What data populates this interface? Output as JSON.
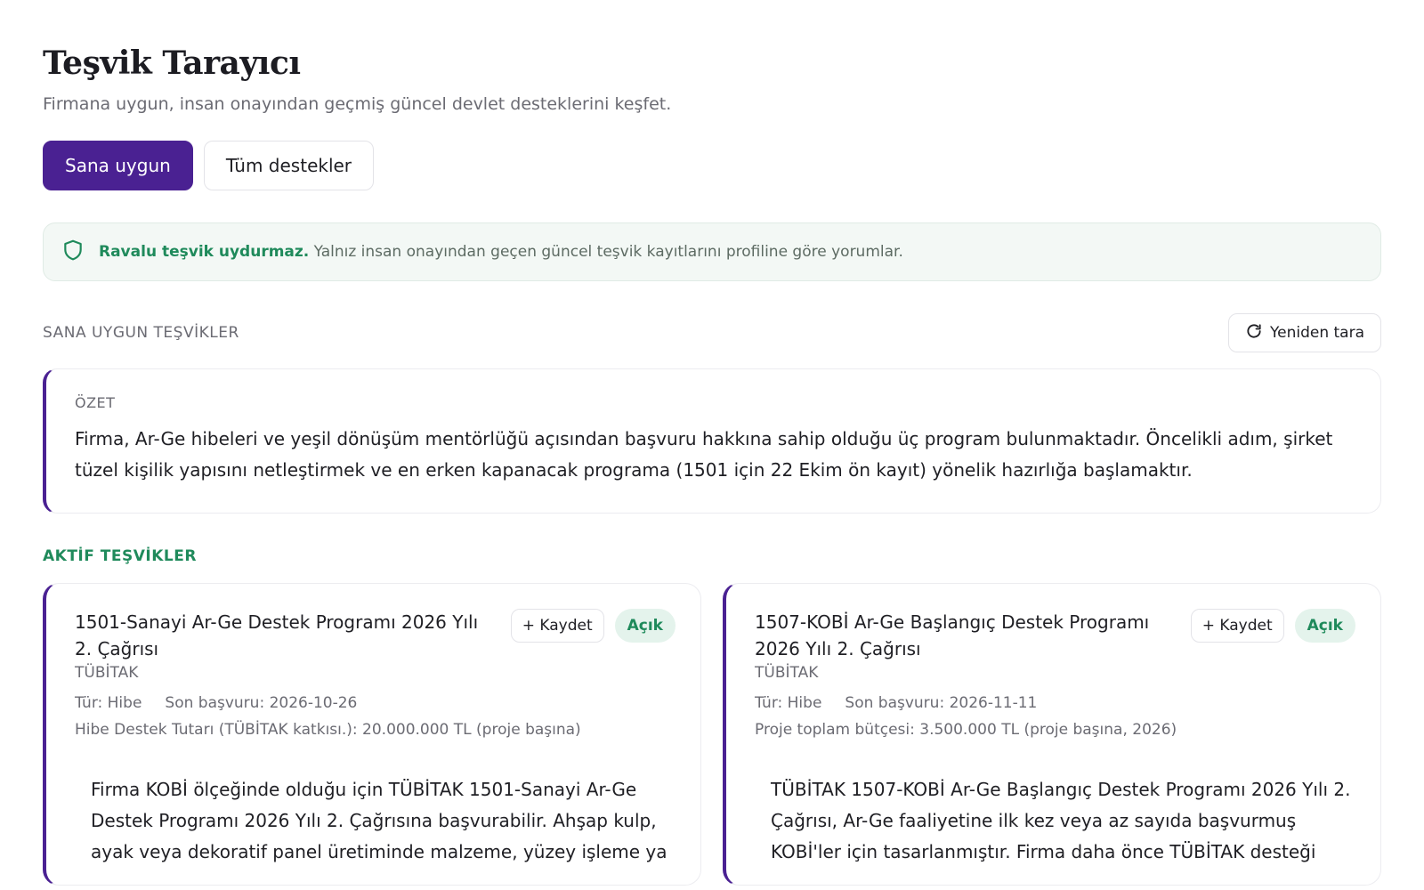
{
  "header": {
    "title": "Teşvik Tarayıcı",
    "subtitle": "Firmana uygun, insan onayından geçmiş güncel devlet desteklerini keşfet."
  },
  "tabs": [
    {
      "label": "Sana uygun",
      "active": true
    },
    {
      "label": "Tüm destekler",
      "active": false
    }
  ],
  "notice": {
    "icon": "shield-icon",
    "strong": "Ravalu teşvik uydurmaz.",
    "text": " Yalnız insan onayından geçen güncel teşvik kayıtlarını profiline göre yorumlar."
  },
  "section": {
    "label": "SANA UYGUN TEŞVİKLER",
    "rescan_label": "Yeniden tara",
    "rescan_icon": "refresh-icon"
  },
  "summary": {
    "label": "ÖZET",
    "text": "Firma, Ar-Ge hibeleri ve yeşil dönüşüm mentörlüğü açısından başvuru hakkına sahip olduğu üç program bulunmaktadır. Öncelikli adım, şirket tüzel kişilik yapısını netleştirmek ve en erken kapanacak programa (1501 için 22 Ekim ön kayıt) yönelik hazırlığa başlamaktır."
  },
  "active": {
    "label": "AKTİF TEŞVİKLER",
    "cards": [
      {
        "title": "1501-Sanayi Ar-Ge Destek Programı 2026 Yılı 2. Çağrısı",
        "save_label": "+ Kaydet",
        "status": "Açık",
        "provider": "TÜBİTAK",
        "type": "Tür: Hibe",
        "deadline": "Son başvuru: 2026-10-26",
        "amount": "Hibe Destek Tutarı (TÜBİTAK katkısı.): 20.000.000 TL (proje başına)",
        "body": "Firma KOBİ ölçeğinde olduğu için TÜBİTAK 1501-Sanayi Ar-Ge Destek Programı 2026 Yılı 2. Çağrısına başvurabilir. Ahşap kulp, ayak veya dekoratif panel üretiminde malzeme, yüzey işleme ya"
      },
      {
        "title": "1507-KOBİ Ar-Ge Başlangıç Destek Programı 2026 Yılı 2. Çağrısı",
        "save_label": "+ Kaydet",
        "status": "Açık",
        "provider": "TÜBİTAK",
        "type": "Tür: Hibe",
        "deadline": "Son başvuru: 2026-11-11",
        "amount": "Proje toplam bütçesi: 3.500.000 TL (proje başına, 2026)",
        "body": "TÜBİTAK 1507-KOBİ Ar-Ge Başlangıç Destek Programı 2026 Yılı 2. Çağrısı, Ar-Ge faaliyetine ilk kez veya az sayıda başvurmuş KOBİ'ler için tasarlanmıştır. Firma daha önce TÜBİTAK desteği"
      }
    ]
  },
  "colors": {
    "accent": "#4a2192",
    "success": "#1f8a5b",
    "notice_bg": "#f3f8f5"
  }
}
